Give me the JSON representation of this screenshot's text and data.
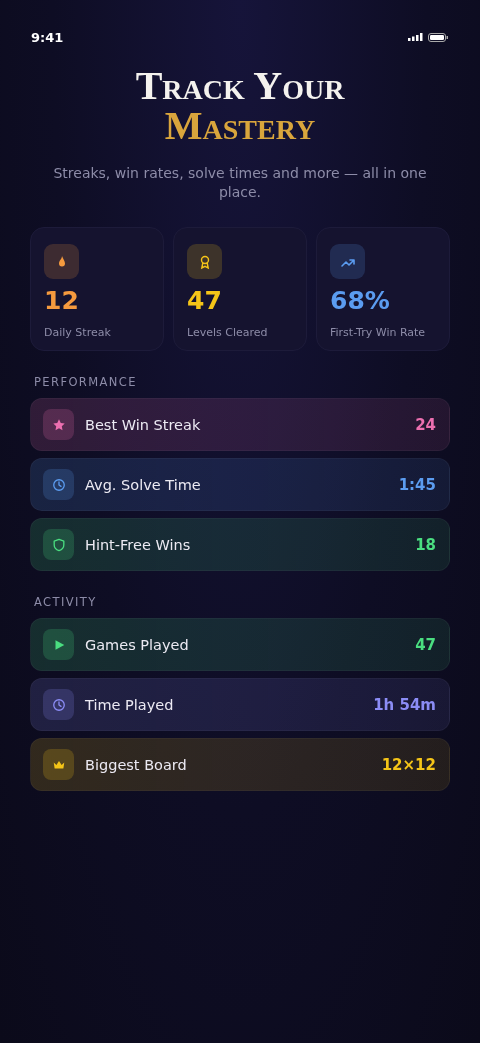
{
  "status_bar": {
    "time": "9:41"
  },
  "header": {
    "title_line_1": "Track Your",
    "title_line_2": "Mastery",
    "subtitle": "Streaks, win rates, solve times and more — all in one place."
  },
  "summary_cards": [
    {
      "value": "12",
      "label": "Daily Streak",
      "color": "#f59a3e"
    },
    {
      "value": "47",
      "label": "Levels Cleared",
      "color": "#f5c518"
    },
    {
      "value": "68%",
      "label": "First-Try Win Rate",
      "color": "#5b9cf0"
    }
  ],
  "sections": [
    {
      "title": "PERFORMANCE",
      "rows": [
        {
          "label": "Best Win Streak",
          "value": "24",
          "color": "#ec6fb0"
        },
        {
          "label": "Avg. Solve Time",
          "value": "1:45",
          "color": "#5b9cf0"
        },
        {
          "label": "Hint-Free Wins",
          "value": "18",
          "color": "#4ade80"
        }
      ]
    },
    {
      "title": "ACTIVITY",
      "rows": [
        {
          "label": "Games Played",
          "value": "47",
          "color": "#4ade80"
        },
        {
          "label": "Time Played",
          "value": "1h 54m",
          "color": "#8b8cf5"
        },
        {
          "label": "Biggest Board",
          "value": "12×12",
          "color": "#f5c518"
        }
      ]
    }
  ]
}
